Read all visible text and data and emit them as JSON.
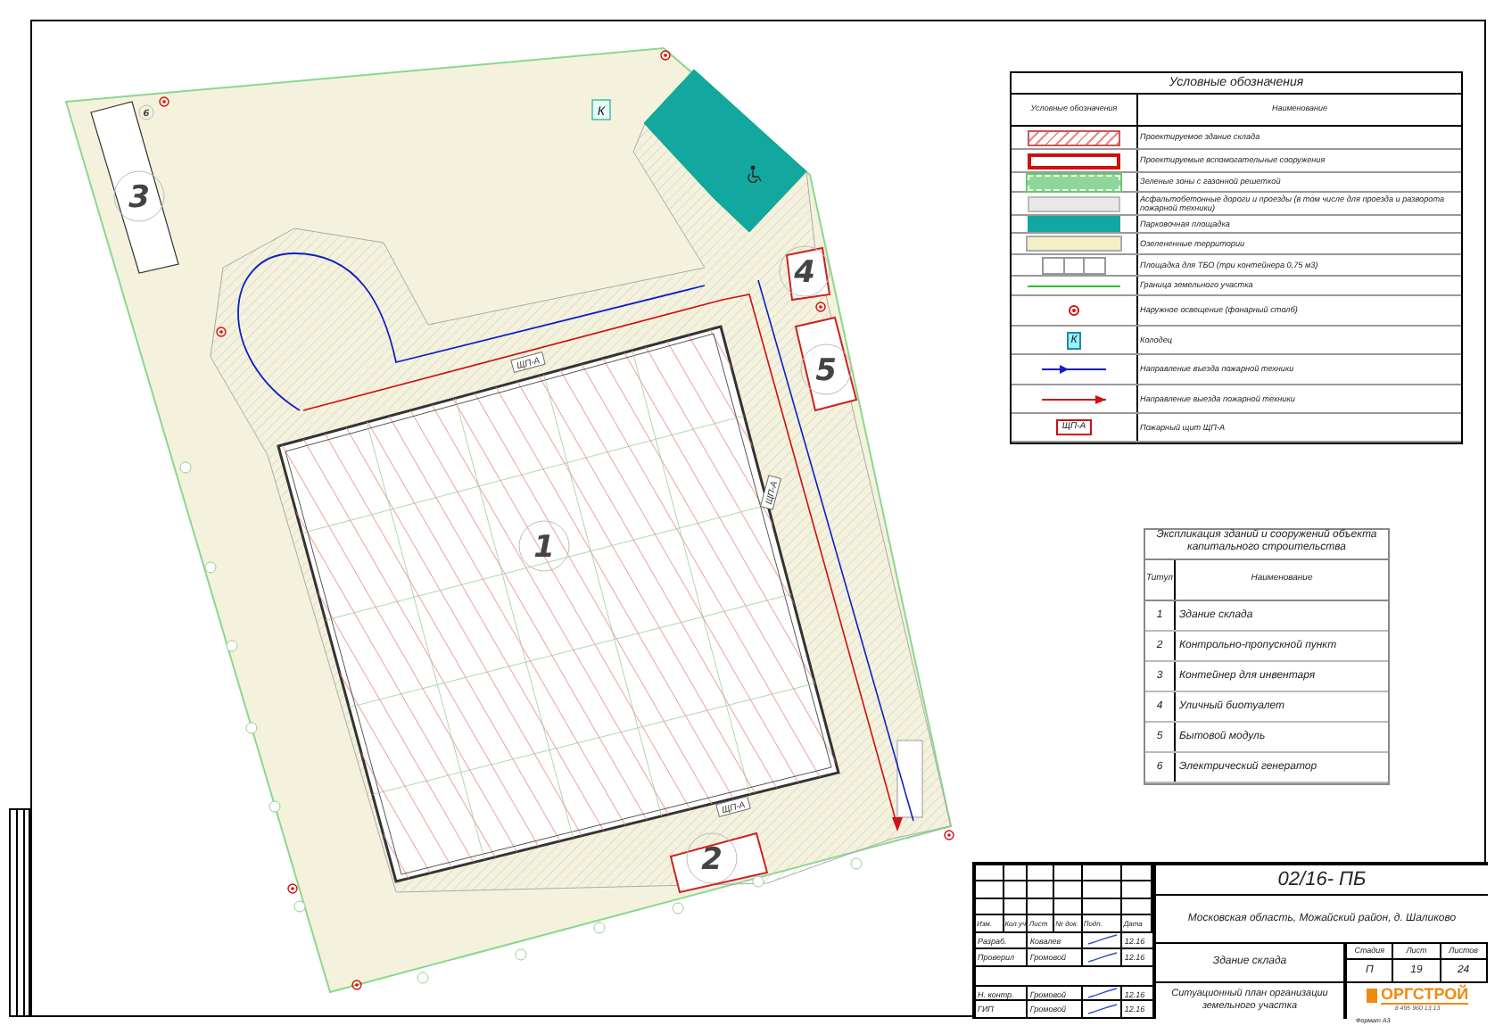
{
  "plan": {
    "markers": [
      {
        "label": "1"
      },
      {
        "label": "2"
      },
      {
        "label": "3"
      },
      {
        "label": "4"
      },
      {
        "label": "5"
      },
      {
        "label": "6"
      }
    ],
    "well_label": "К",
    "fire_shield_labels": [
      "ЩП-А",
      "ЩП-А",
      "ЩП-А"
    ]
  },
  "legend": {
    "title": "Условные обозначения",
    "columns": [
      "Условные обозначения",
      "Наименование"
    ],
    "items": [
      {
        "kind": "hatch",
        "text": "Проектируемое здание склада"
      },
      {
        "kind": "red-outline",
        "text": "Проектируемые вспомогательные сооружения"
      },
      {
        "kind": "green-dashed",
        "text": "Зеленые зоны с газонной решеткой"
      },
      {
        "kind": "gray",
        "text": "Асфальтобетонные дороги и проезды (в том числе для проезда и разворота пожарной техники)"
      },
      {
        "kind": "teal",
        "text": "Парковочная площадка"
      },
      {
        "kind": "beige",
        "text": "Озелененные территории"
      },
      {
        "kind": "bins",
        "text": "Площадка для ТБО (три контейнера 0,75 м3)"
      },
      {
        "kind": "green-line",
        "text": "Граница земельного участка"
      },
      {
        "kind": "lamp",
        "text": "Наружное освещение (фонарный столб)"
      },
      {
        "kind": "well",
        "symbol_text": "К",
        "text": "Колодец"
      },
      {
        "kind": "blue-arrow",
        "text": "Направление въезда пожарной техники"
      },
      {
        "kind": "red-arrow",
        "text": "Направление выезда пожарной техники"
      },
      {
        "kind": "shield",
        "symbol_text": "ЩП-А",
        "text": "Пожарный щит ЩП-А"
      }
    ]
  },
  "explication": {
    "title": "Экспликация зданий и сооружений объекта капитального строительства",
    "columns": [
      "Титул",
      "Наименование"
    ],
    "rows": [
      {
        "number": "1",
        "name": "Здание склада"
      },
      {
        "number": "2",
        "name": "Контрольно-пропускной пункт"
      },
      {
        "number": "3",
        "name": "Контейнер для инвентаря"
      },
      {
        "number": "4",
        "name": "Уличный биотуалет"
      },
      {
        "number": "5",
        "name": "Бытовой модуль"
      },
      {
        "number": "6",
        "name": "Электрический генератор"
      }
    ]
  },
  "title_block": {
    "code": "02/16- ПБ",
    "address": "Московская область, Можайский район, д. Шаликово",
    "object": "Здание склада",
    "sheet_title": "Ситуационный план организации земельного участка",
    "header": [
      "Изм.",
      "Кол.уч",
      "Лист",
      "№ док.",
      "Подп.",
      "Дата"
    ],
    "signers": [
      {
        "role": "Разраб.",
        "name": "Ковалев",
        "signed": true,
        "date": "12.16"
      },
      {
        "role": "Проверил",
        "name": "Громовой",
        "signed": true,
        "date": "12.16"
      },
      {
        "role": "Н. контр.",
        "name": "Громовой",
        "signed": true,
        "date": "12.16"
      },
      {
        "role": "ГИП",
        "name": "Громовой",
        "signed": true,
        "date": "12.16"
      }
    ],
    "stage_header": [
      "Стадия",
      "Лист",
      "Листов"
    ],
    "stage_values": [
      "П",
      "19",
      "24"
    ],
    "company": "ОРГСТРОЙ",
    "phone": "8 495 960 13 13",
    "format": "Формат А3"
  }
}
